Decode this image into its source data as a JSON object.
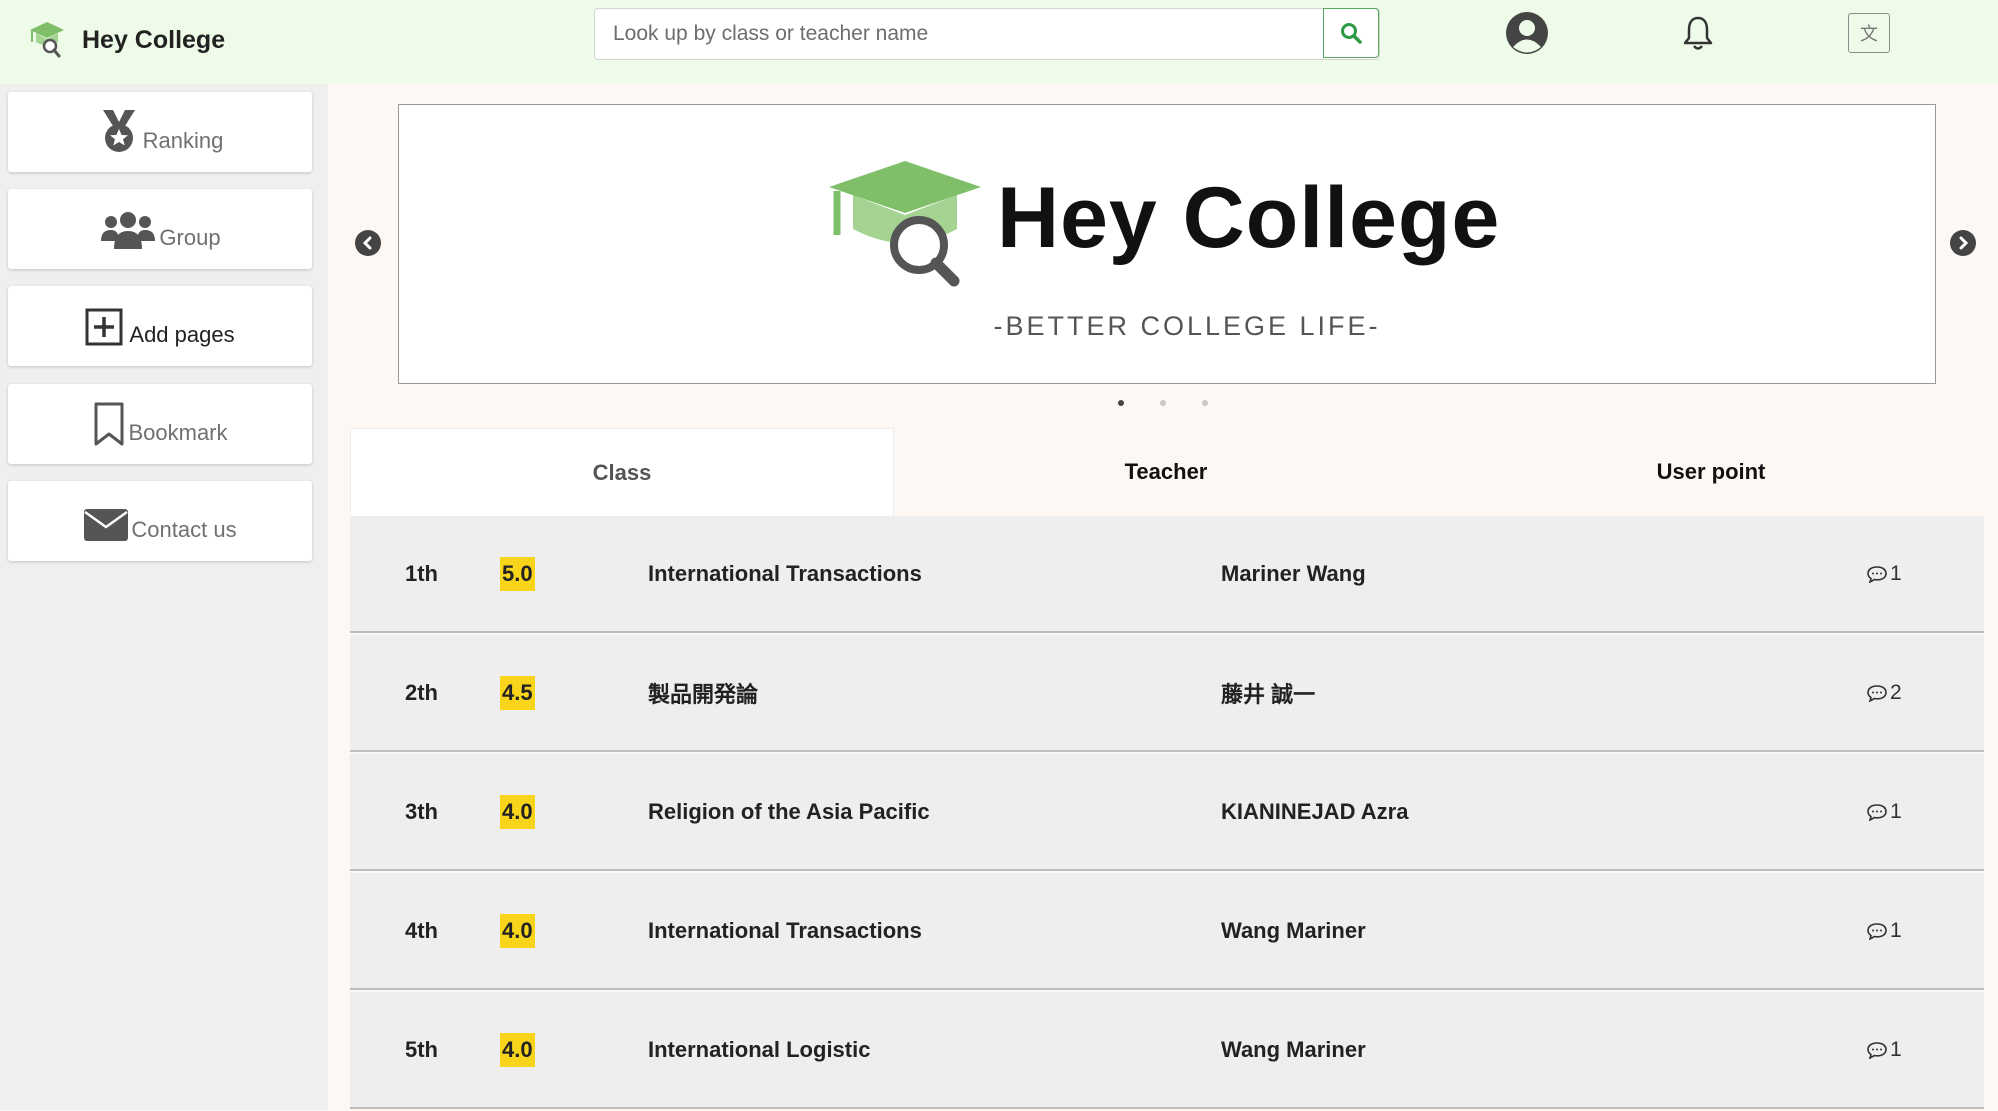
{
  "header": {
    "brand": "Hey College",
    "search": {
      "placeholder": "Look up by class or teacher name",
      "value": ""
    },
    "translate_label": "文",
    "icons": [
      "graduation-cap-logo",
      "search-icon",
      "account-icon",
      "bell-icon",
      "translate-icon"
    ],
    "accent_color": "#7fbf6a"
  },
  "sidebar": {
    "items": [
      {
        "label": "Ranking",
        "icon": "medal-icon"
      },
      {
        "label": "Group",
        "icon": "users-icon"
      },
      {
        "label": "Add pages",
        "icon": "add-page-icon"
      },
      {
        "label": "Bookmark",
        "icon": "bookmark-icon"
      },
      {
        "label": "Contact us",
        "icon": "envelope-icon"
      }
    ]
  },
  "carousel": {
    "title": "Hey College",
    "subtitle": "-BETTER COLLEGE LIFE-",
    "slide_count": 3,
    "active_slide": 1
  },
  "tabs": [
    {
      "label": "Class",
      "active": true
    },
    {
      "label": "Teacher",
      "active": false
    },
    {
      "label": "User point",
      "active": false
    }
  ],
  "ranking": [
    {
      "rank": "1th",
      "score": "5.0",
      "class": "International Transactions",
      "teacher": "Mariner Wang",
      "comments": "1"
    },
    {
      "rank": "2th",
      "score": "4.5",
      "class": "製品開発論",
      "teacher": "藤井 誠一",
      "comments": "2"
    },
    {
      "rank": "3th",
      "score": "4.0",
      "class": "Religion of the Asia Pacific",
      "teacher": "KIANINEJAD Azra",
      "comments": "1"
    },
    {
      "rank": "4th",
      "score": "4.0",
      "class": "International Transactions",
      "teacher": "Wang Mariner",
      "comments": "1"
    },
    {
      "rank": "5th",
      "score": "4.0",
      "class": "International Logistic",
      "teacher": "Wang Mariner",
      "comments": "1"
    }
  ]
}
